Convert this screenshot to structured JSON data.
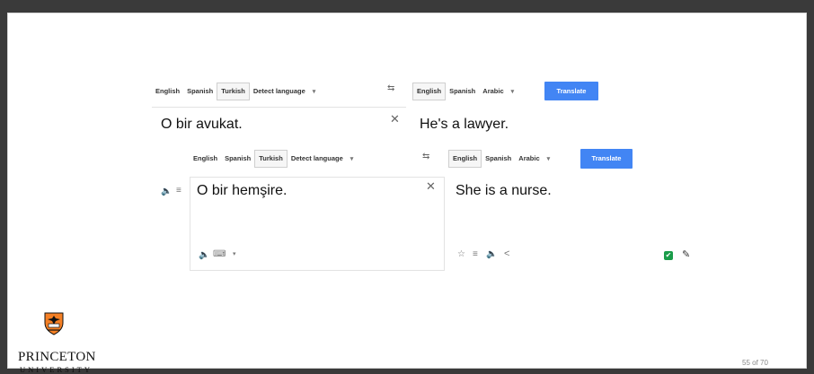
{
  "top": {
    "source_langs": [
      "English",
      "Spanish",
      "Turkish",
      "Detect language"
    ],
    "target_langs": [
      "English",
      "Spanish",
      "Arabic"
    ],
    "translate_label": "Translate",
    "source_text": "O bir avukat.",
    "target_text": "He's a lawyer."
  },
  "bottom": {
    "source_langs": [
      "English",
      "Spanish",
      "Turkish",
      "Detect language"
    ],
    "target_langs": [
      "English",
      "Spanish",
      "Arabic"
    ],
    "translate_label": "Translate",
    "source_text": "O bir hemşire.",
    "target_text": "She is a nurse."
  },
  "glyphs": {
    "caret": "▾",
    "swap": "⇆",
    "close": "✕",
    "speaker": "🔈",
    "doc": "≡",
    "keyboard": "⌨",
    "star": "☆",
    "share": "<",
    "check": "✔",
    "pencil": "✎"
  },
  "logo": {
    "line1": "PRINCETON",
    "line2": "UNIVERSITY"
  },
  "page_number": "55 of 70",
  "colors": {
    "translate_button": "#4285f4",
    "check_green": "#1a9c4a",
    "shield_orange": "#f58025"
  }
}
